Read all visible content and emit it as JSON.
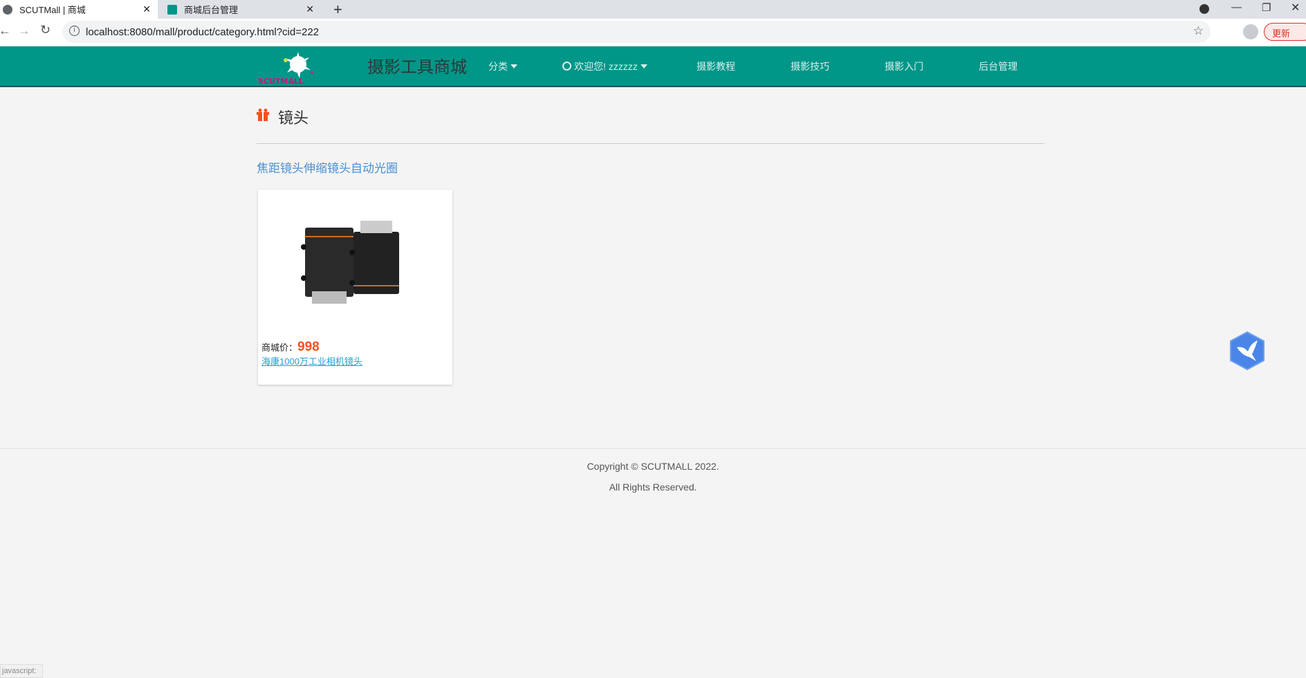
{
  "browser": {
    "tabs": [
      {
        "title": "SCUTMall | 商城",
        "active": true
      },
      {
        "title": "商城后台管理",
        "active": false
      }
    ],
    "url": "localhost:8080/mall/product/category.html?cid=222",
    "update_label": "更新",
    "status_text": "javascript:"
  },
  "header": {
    "logo_text": "SCUTMALL",
    "site_title": "摄影工具商城",
    "nav": {
      "category": "分类",
      "welcome": "欢迎您! zzzzzz",
      "tutorial": "摄影教程",
      "skills": "摄影技巧",
      "intro": "摄影入门",
      "admin": "后台管理"
    },
    "color": "#009688"
  },
  "main": {
    "category_title": "镜头",
    "subcategory_link": "焦距镜头伸缩镜头自动光圈",
    "products": [
      {
        "price_label": "商城价：",
        "price": "998",
        "name": "海康1000万工业相机镜头"
      }
    ]
  },
  "footer": {
    "copyright": "Copyright © SCUTMALL 2022.",
    "rights": "All Rights Reserved."
  }
}
